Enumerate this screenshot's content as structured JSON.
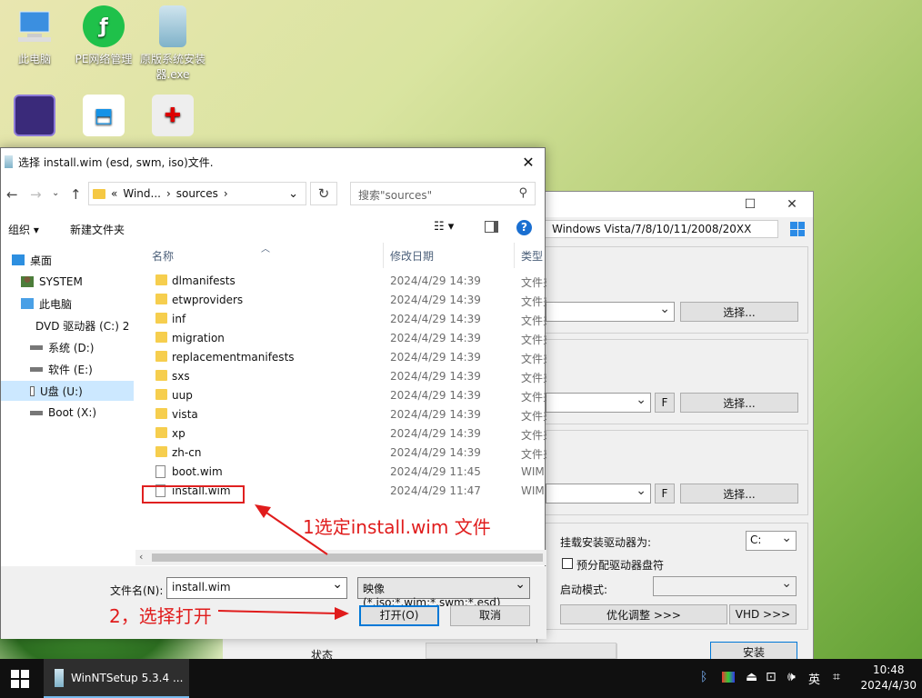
{
  "desktop": {
    "icons": [
      {
        "label": "此电脑"
      },
      {
        "label": "PE网络管理"
      },
      {
        "label": "原版系统安装器.exe"
      }
    ]
  },
  "back_window": {
    "version_field": "Windows Vista/7/8/10/11/2008/20XX",
    "select_button_1": "选择...",
    "select_button_2": "选择...",
    "select_button_3": "选择...",
    "f_button_1": "F",
    "f_button_2": "F",
    "mount_label": "挂载安装驱动器为:",
    "mount_value": "C:",
    "prealloc_label": "预分配驱动器盘符",
    "boot_mode_label": "启动模式:",
    "optimize_button": "优化调整 >>>",
    "vhd_button": "VHD >>>",
    "status_label": "状态",
    "install_button": "安装"
  },
  "dialog": {
    "title": "选择 install.wim (esd, swm, iso)文件.",
    "address": [
      "«",
      "Wind...",
      "›",
      "sources",
      "›"
    ],
    "search_placeholder": "搜索\"sources\"",
    "toolbar": {
      "organize": "组织 ▾",
      "new_folder": "新建文件夹",
      "help": "?"
    },
    "nav_items": [
      {
        "label": "桌面",
        "icon": "desktop-icon"
      },
      {
        "label": "SYSTEM",
        "icon": "user-icon"
      },
      {
        "label": "此电脑",
        "icon": "computer-icon"
      },
      {
        "label": "DVD 驱动器 (C:) 2",
        "icon": "dvd-icon"
      },
      {
        "label": "系统 (D:)",
        "icon": "drive-icon"
      },
      {
        "label": "软件 (E:)",
        "icon": "drive-icon"
      },
      {
        "label": "U盘 (U:)",
        "icon": "usb-icon"
      },
      {
        "label": "Boot (X:)",
        "icon": "drive-icon"
      }
    ],
    "columns": {
      "name": "名称",
      "date": "修改日期",
      "type": "类型"
    },
    "files": [
      {
        "name": "dlmanifests",
        "date": "2024/4/29 14:39",
        "type": "文件夹",
        "kind": "folder"
      },
      {
        "name": "etwproviders",
        "date": "2024/4/29 14:39",
        "type": "文件夹",
        "kind": "folder"
      },
      {
        "name": "inf",
        "date": "2024/4/29 14:39",
        "type": "文件夹",
        "kind": "folder"
      },
      {
        "name": "migration",
        "date": "2024/4/29 14:39",
        "type": "文件夹",
        "kind": "folder"
      },
      {
        "name": "replacementmanifests",
        "date": "2024/4/29 14:39",
        "type": "文件夹",
        "kind": "folder"
      },
      {
        "name": "sxs",
        "date": "2024/4/29 14:39",
        "type": "文件夹",
        "kind": "folder"
      },
      {
        "name": "uup",
        "date": "2024/4/29 14:39",
        "type": "文件夹",
        "kind": "folder"
      },
      {
        "name": "vista",
        "date": "2024/4/29 14:39",
        "type": "文件夹",
        "kind": "folder"
      },
      {
        "name": "xp",
        "date": "2024/4/29 14:39",
        "type": "文件夹",
        "kind": "folder"
      },
      {
        "name": "zh-cn",
        "date": "2024/4/29 14:39",
        "type": "文件夹",
        "kind": "folder"
      },
      {
        "name": "boot.wim",
        "date": "2024/4/29 11:45",
        "type": "WIM",
        "kind": "file"
      },
      {
        "name": "install.wim",
        "date": "2024/4/29 11:47",
        "type": "WIM",
        "kind": "file"
      }
    ],
    "filename_label": "文件名(N):",
    "filename_value": "install.wim",
    "filter_value": "映像 (*.iso;*.wim;*.swm;*.esd)",
    "open_button": "打开(O)",
    "cancel_button": "取消"
  },
  "annotations": {
    "step1": "1选定install.wim 文件",
    "step2": "2，选择打开"
  },
  "taskbar": {
    "app_label": "WinNTSetup 5.3.4 ...",
    "ime": "英",
    "time": "10:48",
    "date": "2024/4/30"
  },
  "colors": {
    "annotation": "#e01c1c",
    "accent": "#0078d7"
  }
}
